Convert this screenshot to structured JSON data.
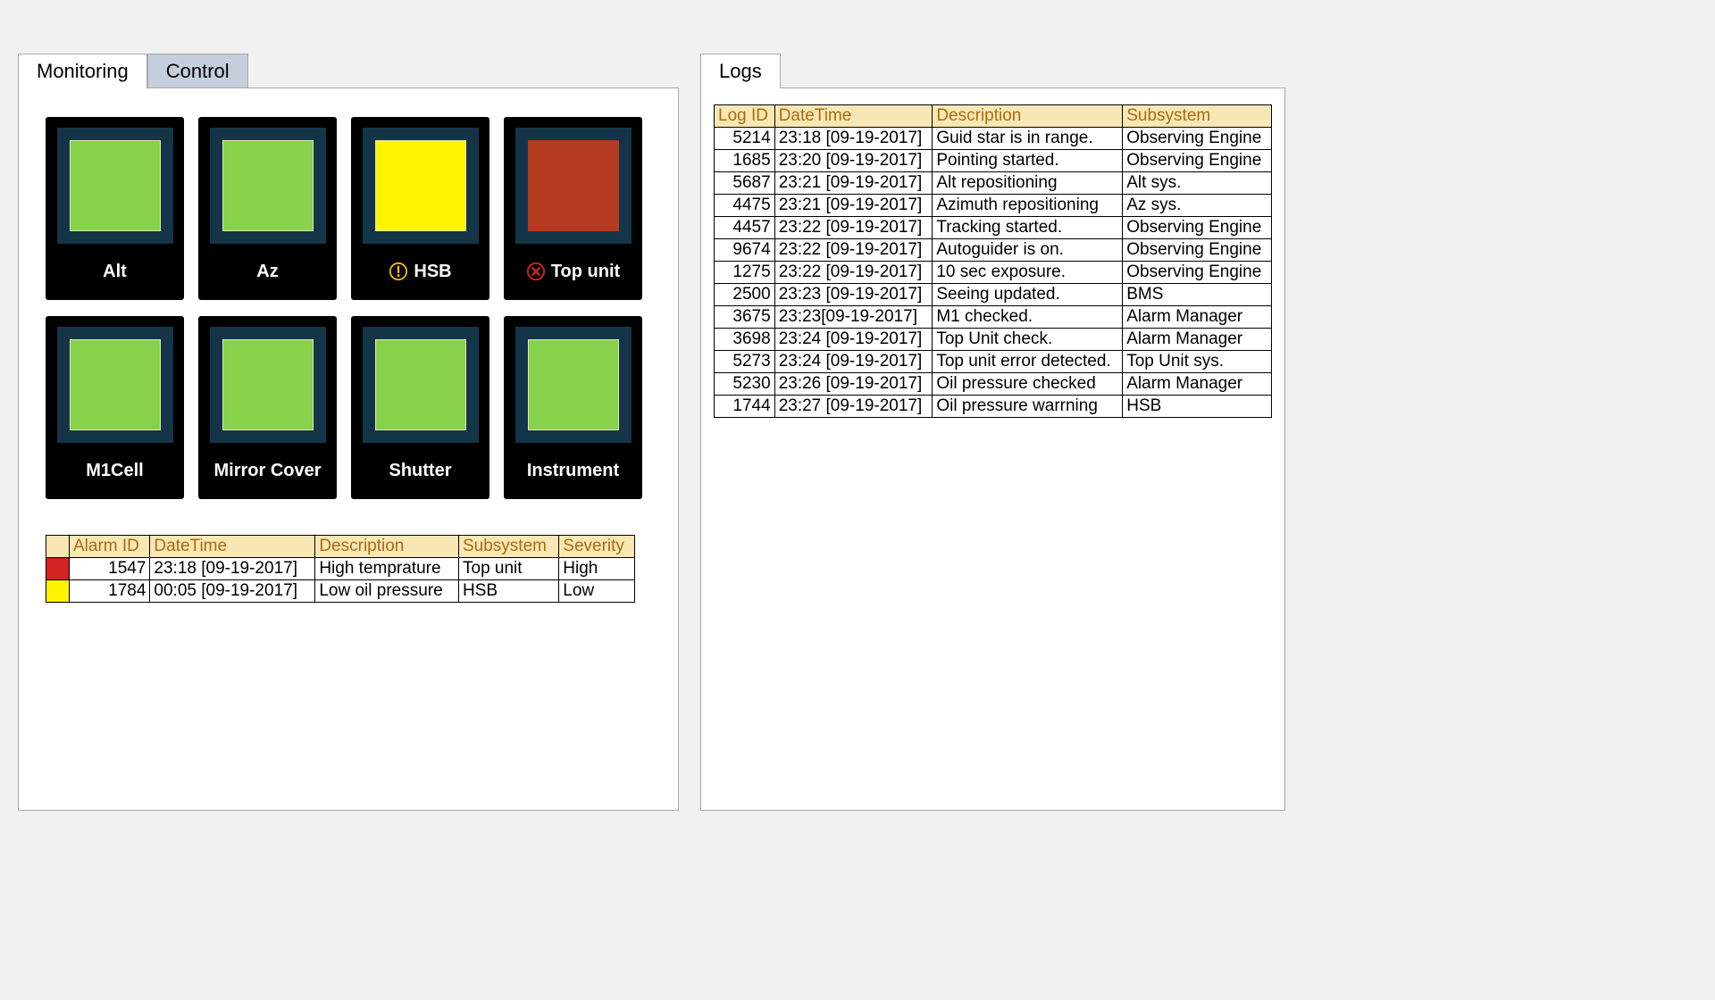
{
  "left_tabs": [
    {
      "label": "Monitoring",
      "active": true
    },
    {
      "label": "Control",
      "active": false
    }
  ],
  "right_tabs": [
    {
      "label": "Logs",
      "active": true
    }
  ],
  "tiles": [
    {
      "name": "Alt",
      "status": "green",
      "icon": "none"
    },
    {
      "name": "Az",
      "status": "green",
      "icon": "none"
    },
    {
      "name": "HSB",
      "status": "yellow",
      "icon": "warning"
    },
    {
      "name": "Top unit",
      "status": "red",
      "icon": "error"
    },
    {
      "name": "M1Cell",
      "status": "green",
      "icon": "none"
    },
    {
      "name": "Mirror Cover",
      "status": "green",
      "icon": "none"
    },
    {
      "name": "Shutter",
      "status": "green",
      "icon": "none"
    },
    {
      "name": "Instrument",
      "status": "green",
      "icon": "none"
    }
  ],
  "alarm_table": {
    "headers": [
      "",
      "Alarm ID",
      "DateTime",
      "Description",
      "Subsystem",
      "Severity"
    ],
    "rows": [
      {
        "color": "red",
        "id": "1547",
        "dt": "23:18 [09-19-2017]",
        "desc": "High temprature",
        "sub": "Top unit",
        "sev": "High"
      },
      {
        "color": "yellow",
        "id": "1784",
        "dt": "00:05 [09-19-2017]",
        "desc": "Low oil pressure",
        "sub": "HSB",
        "sev": "Low"
      }
    ]
  },
  "log_table": {
    "headers": [
      "Log ID",
      "DateTime",
      "Description",
      "Subsystem"
    ],
    "rows": [
      {
        "id": "5214",
        "dt": "23:18 [09-19-2017]",
        "desc": "Guid star is in range.",
        "sub": "Observing Engine"
      },
      {
        "id": "1685",
        "dt": "23:20 [09-19-2017]",
        "desc": "Pointing started.",
        "sub": "Observing Engine"
      },
      {
        "id": "5687",
        "dt": "23:21 [09-19-2017]",
        "desc": "Alt repositioning",
        "sub": "Alt sys."
      },
      {
        "id": "4475",
        "dt": "23:21 [09-19-2017]",
        "desc": "Azimuth repositioning",
        "sub": "Az sys."
      },
      {
        "id": "4457",
        "dt": "23:22 [09-19-2017]",
        "desc": "Tracking started.",
        "sub": "Observing Engine"
      },
      {
        "id": "9674",
        "dt": "23:22 [09-19-2017]",
        "desc": "Autoguider is on.",
        "sub": "Observing Engine"
      },
      {
        "id": "1275",
        "dt": "23:22 [09-19-2017]",
        "desc": "10 sec exposure.",
        "sub": "Observing Engine"
      },
      {
        "id": "2500",
        "dt": "23:23 [09-19-2017]",
        "desc": "Seeing updated.",
        "sub": "BMS"
      },
      {
        "id": "3675",
        "dt": "23:23[09-19-2017]",
        "desc": "M1 checked.",
        "sub": "Alarm Manager"
      },
      {
        "id": "3698",
        "dt": "23:24 [09-19-2017]",
        "desc": "Top Unit check.",
        "sub": "Alarm Manager"
      },
      {
        "id": "5273",
        "dt": "23:24 [09-19-2017]",
        "desc": "Top unit error detected.",
        "sub": "Top Unit sys."
      },
      {
        "id": "5230",
        "dt": "23:26 [09-19-2017]",
        "desc": "Oil pressure checked",
        "sub": "Alarm Manager"
      },
      {
        "id": "1744",
        "dt": "23:27 [09-19-2017]",
        "desc": "Oil pressure warrning",
        "sub": "HSB"
      }
    ]
  }
}
